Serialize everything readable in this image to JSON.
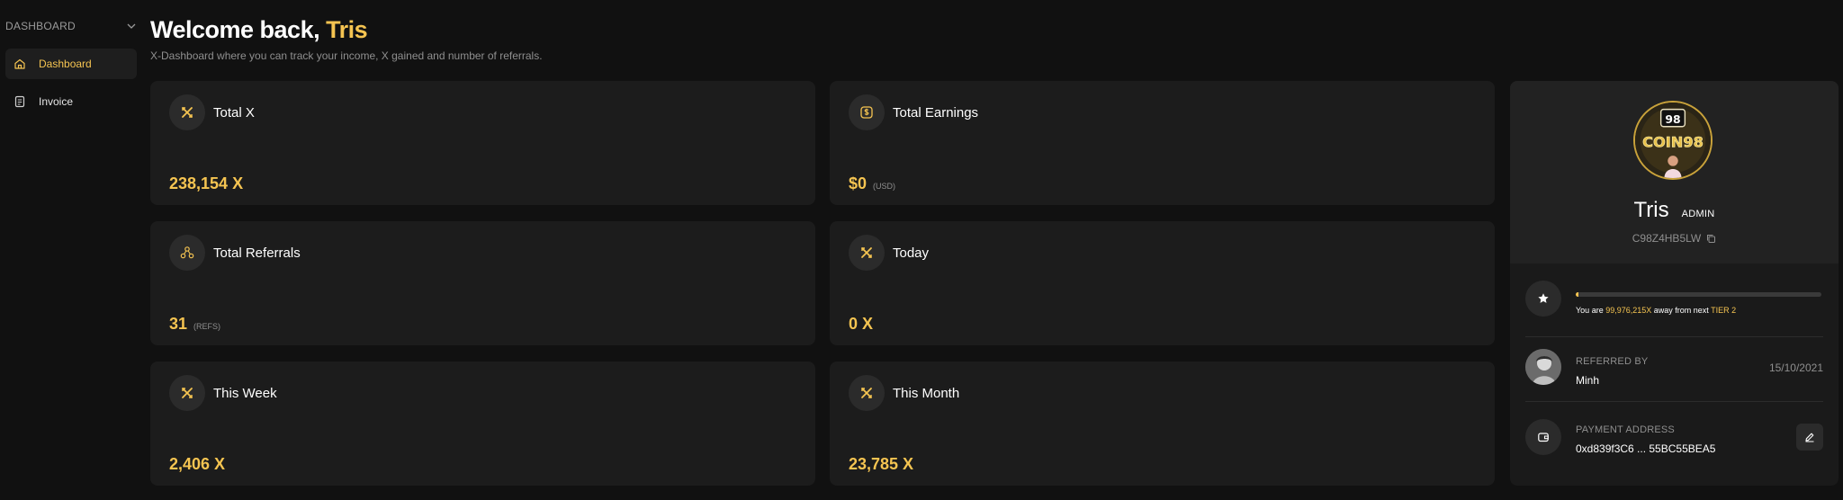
{
  "colors": {
    "accent": "#f5c451",
    "background": "#111111",
    "card": "#1c1c1c"
  },
  "sidebar": {
    "header": "DASHBOARD",
    "header_icon": "chevron-down-icon",
    "items": [
      {
        "label": "Dashboard",
        "icon": "home-icon",
        "active": true
      },
      {
        "label": "Invoice",
        "icon": "invoice-icon",
        "active": false
      }
    ]
  },
  "header": {
    "greeting": "Welcome back, ",
    "name": "Tris",
    "subtitle": "X-Dashboard where you can track your income, X gained and number of referrals."
  },
  "stats": [
    {
      "title": "Total X",
      "value": "238,154 X",
      "unit": "",
      "icon": "x-logo-icon"
    },
    {
      "title": "Total Earnings",
      "value": "$0",
      "unit": "(USD)",
      "icon": "dollar-icon"
    },
    {
      "title": "Total Referrals",
      "value": "31",
      "unit": "(REFS)",
      "icon": "referrals-icon"
    },
    {
      "title": "Today",
      "value": "0 X",
      "unit": "",
      "icon": "x-logo-icon"
    },
    {
      "title": "This Week",
      "value": "2,406 X",
      "unit": "",
      "icon": "x-logo-icon"
    },
    {
      "title": "This Month",
      "value": "23,785 X",
      "unit": "",
      "icon": "x-logo-icon"
    }
  ],
  "profile": {
    "name": "Tris",
    "role": "ADMIN",
    "code": "C98Z4HB5LW",
    "avatar_icon": "coin98-avatar",
    "tier": {
      "progress": 0.01,
      "prefix": "You are ",
      "amount": "99,976,215X",
      "middle": " away from next ",
      "next_tier": "TIER 2"
    },
    "referred_by": {
      "label": "REFERRED BY",
      "name": "Minh",
      "date": "15/10/2021"
    },
    "payment": {
      "label": "PAYMENT ADDRESS",
      "address": "0xd839f3C6 ... 55BC55BEA5"
    }
  }
}
